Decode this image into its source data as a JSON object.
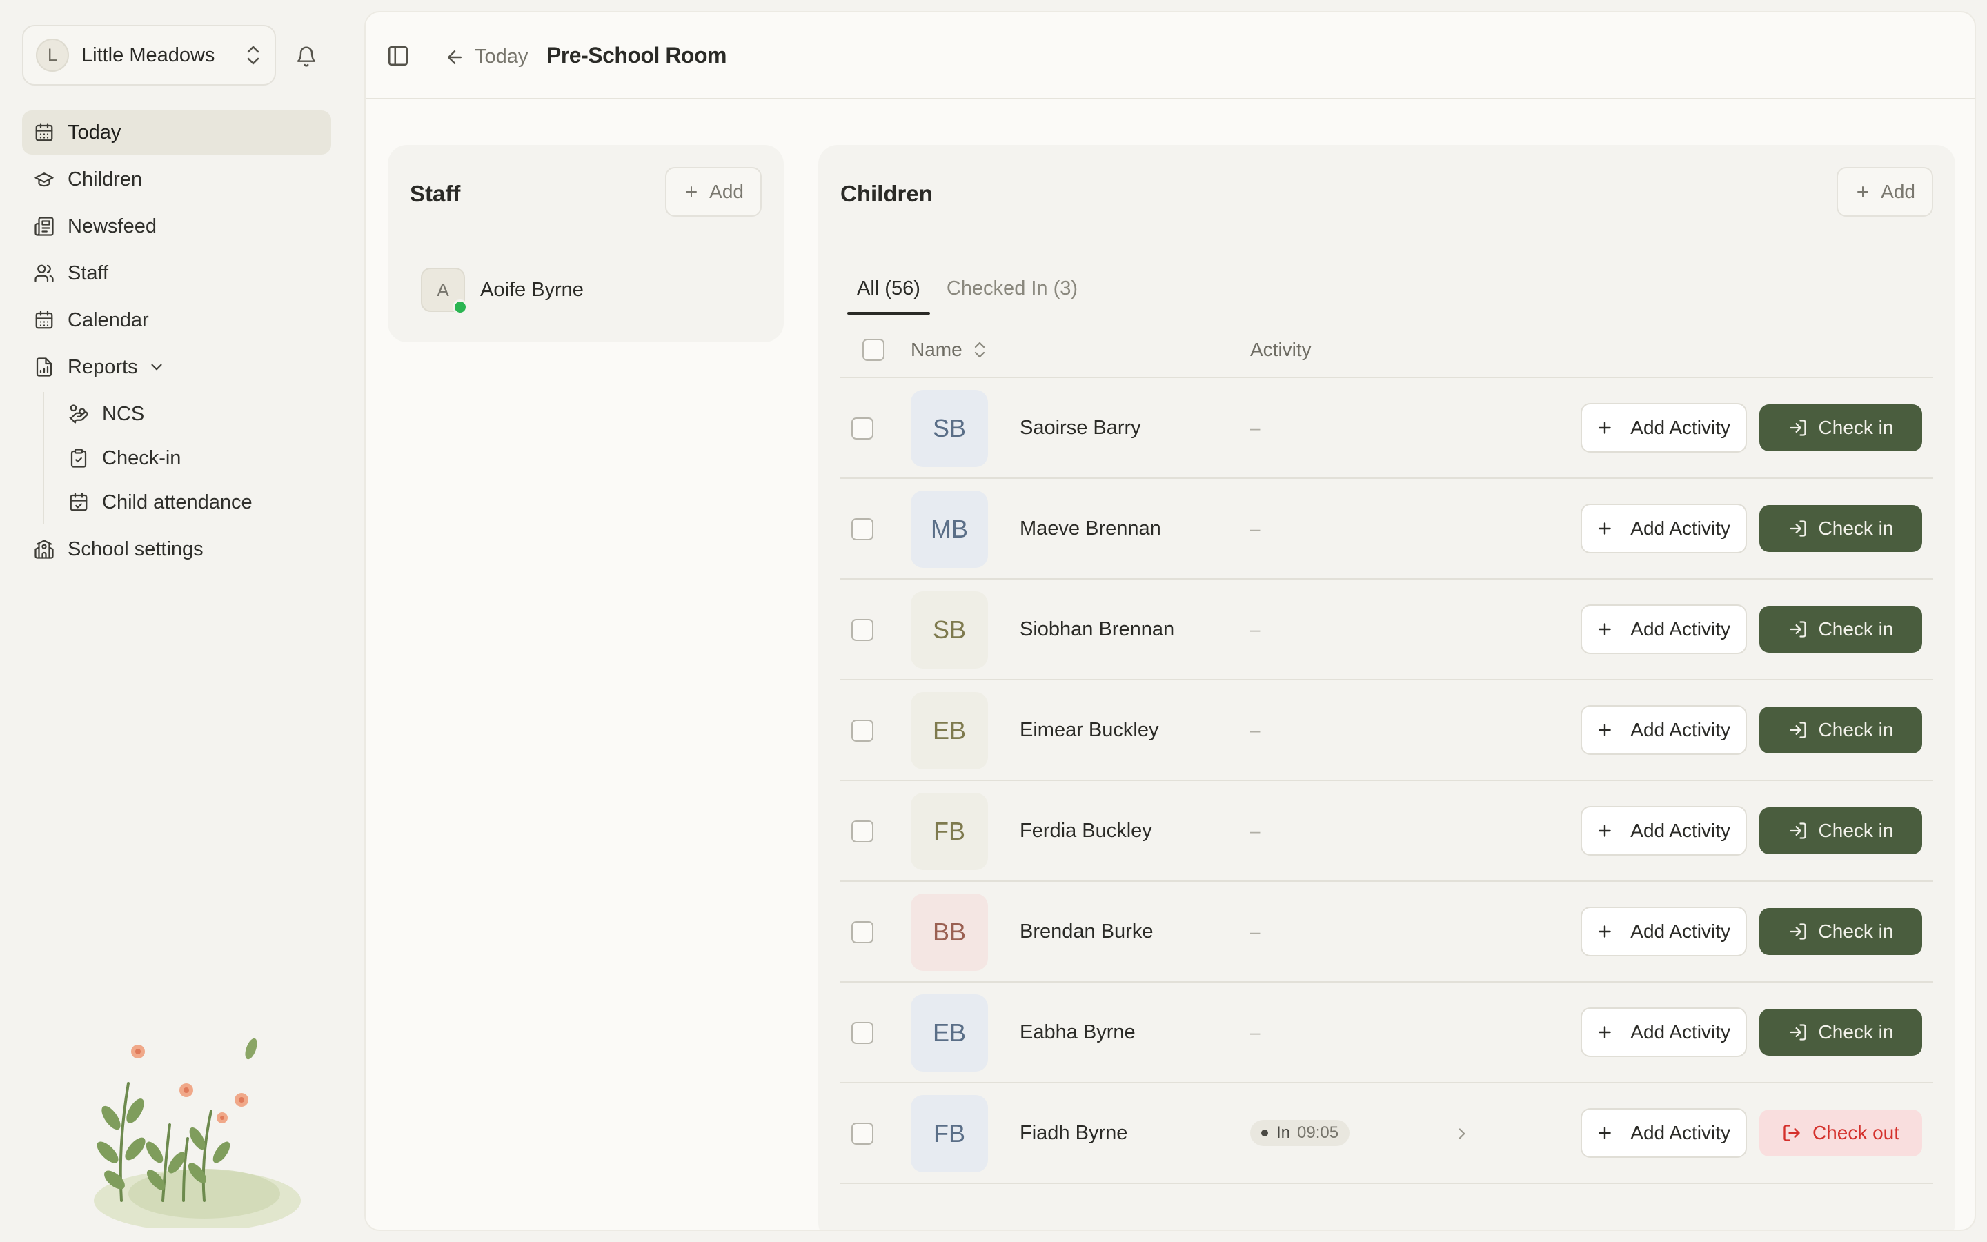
{
  "school": {
    "initial": "L",
    "name": "Little Meadows"
  },
  "nav": {
    "items": [
      {
        "label": "Today",
        "icon": "calendar-icon"
      },
      {
        "label": "Children",
        "icon": "graduation-cap-icon"
      },
      {
        "label": "Newsfeed",
        "icon": "newspaper-icon"
      },
      {
        "label": "Staff",
        "icon": "users-icon"
      },
      {
        "label": "Calendar",
        "icon": "calendar-icon"
      },
      {
        "label": "Reports",
        "icon": "file-chart-icon"
      }
    ],
    "report_subitems": [
      {
        "label": "NCS",
        "icon": "hand-coins-icon"
      },
      {
        "label": "Check-in",
        "icon": "clipboard-check-icon"
      },
      {
        "label": "Child attendance",
        "icon": "calendar-check-icon"
      }
    ],
    "school_settings": {
      "label": "School settings",
      "icon": "school-icon"
    }
  },
  "breadcrumb": {
    "back_label": "Today",
    "title": "Pre-School Room"
  },
  "staff": {
    "title": "Staff",
    "add_label": "Add",
    "members": [
      {
        "initial": "A",
        "name": "Aoife Byrne",
        "online": true
      }
    ]
  },
  "children": {
    "title": "Children",
    "add_label": "Add",
    "tabs": [
      {
        "label": "All (56)",
        "active": true
      },
      {
        "label": "Checked In (3)",
        "active": false
      }
    ],
    "columns": {
      "name": "Name",
      "activity": "Activity"
    },
    "add_activity_label": "Add Activity",
    "check_in_label": "Check in",
    "check_out_label": "Check out",
    "rows": [
      {
        "initials": "SB",
        "name": "Saoirse Barry",
        "activity": "–",
        "status": null,
        "bg": "#e7ebf1",
        "fg": "#5a6e87"
      },
      {
        "initials": "MB",
        "name": "Maeve Brennan",
        "activity": "–",
        "status": null,
        "bg": "#e7ebf1",
        "fg": "#5a6e87"
      },
      {
        "initials": "SB",
        "name": "Siobhan Brennan",
        "activity": "–",
        "status": null,
        "bg": "#efeee6",
        "fg": "#7e7a4e"
      },
      {
        "initials": "EB",
        "name": "Eimear Buckley",
        "activity": "–",
        "status": null,
        "bg": "#efeee6",
        "fg": "#7e7a4e"
      },
      {
        "initials": "FB",
        "name": "Ferdia Buckley",
        "activity": "–",
        "status": null,
        "bg": "#efeee6",
        "fg": "#7e7a4e"
      },
      {
        "initials": "BB",
        "name": "Brendan Burke",
        "activity": "–",
        "status": null,
        "bg": "#f4e6e3",
        "fg": "#9a6052"
      },
      {
        "initials": "EB",
        "name": "Eabha Byrne",
        "activity": "–",
        "status": null,
        "bg": "#e7ebf1",
        "fg": "#5a6e87"
      },
      {
        "initials": "FB",
        "name": "Fiadh Byrne",
        "activity": "",
        "status": {
          "label": "In",
          "time": "09:05"
        },
        "bg": "#e7ebf1",
        "fg": "#5a6e87"
      }
    ]
  },
  "colors": {
    "accent_green": "#4a5d3e",
    "check_out_bg": "#f9dede",
    "check_out_text": "#d4302b",
    "online": "#2bb552"
  }
}
